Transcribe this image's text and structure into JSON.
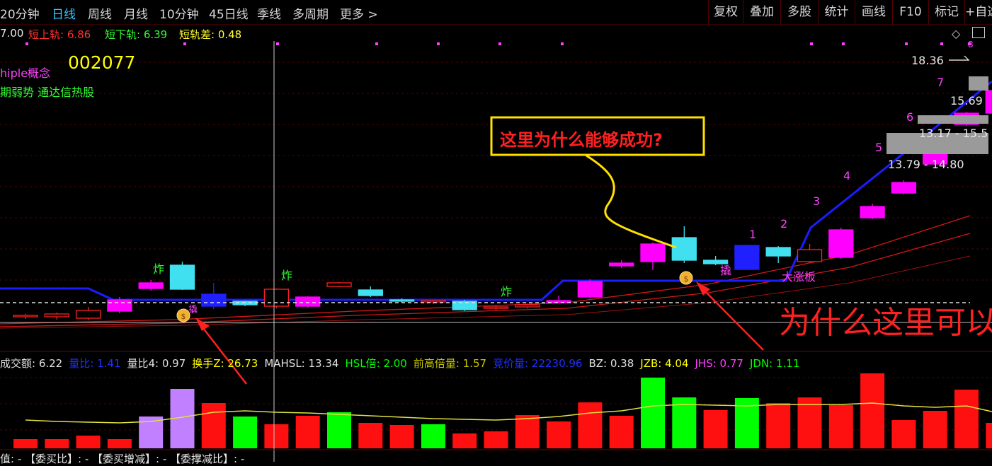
{
  "toolbar": {
    "periods": [
      {
        "label": "20分钟",
        "active": false
      },
      {
        "label": "日线",
        "active": true
      },
      {
        "label": "周线",
        "active": false
      },
      {
        "label": "月线",
        "active": false
      },
      {
        "label": "10分钟",
        "active": false
      },
      {
        "label": "45日线",
        "active": false
      },
      {
        "label": "季线",
        "active": false
      },
      {
        "label": "多周期",
        "active": false
      },
      {
        "label": "更多 >",
        "active": false
      }
    ],
    "buttons": [
      "复权",
      "叠加",
      "多股",
      "统计",
      "画线",
      "F10",
      "标记",
      "+自选"
    ]
  },
  "indicator_line": {
    "prefix": "7.00",
    "upper_label": "短上轨: ",
    "upper_value": "6.86",
    "lower_label": "短下轨: ",
    "lower_value": "6.39",
    "diff_label": "短轨差: ",
    "diff_value": "0.48"
  },
  "stock": {
    "concept": "hiple概念",
    "code": "002077",
    "trend": "期弱势 通达信热股"
  },
  "annotations": {
    "callout": "这里为什么能够成功?",
    "red_question": "为什么这里可以",
    "board": "大涨板",
    "zha_marks": [
      "炸",
      "炸",
      "炸"
    ],
    "tiao_mark": "撬",
    "lian_mark": "撬"
  },
  "price_labels": {
    "p1": "18.36",
    "p2": "15.69",
    "p3": "13.17 - 15.5",
    "p4": "13.79 - 14.80"
  },
  "step_numbers": [
    "1",
    "2",
    "3",
    "4",
    "5",
    "6",
    "7",
    "8"
  ],
  "volume_info": [
    {
      "label": "成交额: ",
      "value": "6.22",
      "color": "#e0e0e0"
    },
    {
      "label": "量比: ",
      "value": "1.41",
      "color": "#2030ff"
    },
    {
      "label": "量比4: ",
      "value": "0.97",
      "color": "#e0e0e0"
    },
    {
      "label": "换手Z: ",
      "value": "26.73",
      "color": "#ffff00"
    },
    {
      "label": "MAHSL: ",
      "value": "13.34",
      "color": "#e0e0e0"
    },
    {
      "label": "HSL倍: ",
      "value": "2.00",
      "color": "#00ff00"
    },
    {
      "label": "前高倍量: ",
      "value": "1.57",
      "color": "#c8c800"
    },
    {
      "label": "竞价量: ",
      "value": "22230.96",
      "color": "#2030ff"
    },
    {
      "label": "BZ: ",
      "value": "0.38",
      "color": "#e0e0e0"
    },
    {
      "label": "JZB: ",
      "value": "4.04",
      "color": "#ffff00"
    },
    {
      "label": "JHS: ",
      "value": "0.77",
      "color": "#ff40ff"
    },
    {
      "label": "JDN: ",
      "value": "1.11",
      "color": "#00ff00"
    }
  ],
  "bottom_bar": "值: - 【委买比】: - 【委买增减】: - 【委撑减比】: -",
  "chart_data": {
    "type": "candlestick",
    "candles": [
      {
        "o": 446,
        "c": 448,
        "h": 444,
        "l": 451,
        "col": "#ff2020",
        "fill": false
      },
      {
        "o": 448,
        "c": 444,
        "h": 442,
        "l": 452,
        "col": "#ff2020",
        "fill": false
      },
      {
        "o": 450,
        "c": 439,
        "h": 434,
        "l": 453,
        "col": "#ff2020",
        "fill": false
      },
      {
        "o": 440,
        "c": 424,
        "h": 420,
        "l": 443,
        "col": "#ff00ff",
        "fill": true
      },
      {
        "o": 408,
        "c": 400,
        "h": 396,
        "l": 411,
        "col": "#ff00ff",
        "fill": true
      },
      {
        "o": 409,
        "c": 375,
        "h": 370,
        "l": 410,
        "col": "#40e0f0",
        "fill": true
      },
      {
        "o": 416,
        "c": 433,
        "h": 400,
        "l": 437,
        "col": "#2020ff",
        "fill": true
      },
      {
        "o": 426,
        "c": 431,
        "h": 425,
        "l": 433,
        "col": "#40e0f0",
        "fill": true
      },
      {
        "o": 433,
        "c": 409,
        "h": 408,
        "l": 436,
        "col": "#ff2020",
        "fill": false
      },
      {
        "o": 420,
        "c": 433,
        "h": 419,
        "l": 435,
        "col": "#ff00ff",
        "fill": true
      },
      {
        "o": 405,
        "c": 400,
        "h": 399,
        "l": 406,
        "col": "#ff2020",
        "fill": false
      },
      {
        "o": 410,
        "c": 418,
        "h": 405,
        "l": 420,
        "col": "#40e0f0",
        "fill": true
      },
      {
        "o": 424,
        "c": 426,
        "h": 422,
        "l": 428,
        "col": "#40e0f0",
        "fill": true
      },
      {
        "o": 425,
        "c": 427,
        "h": 424,
        "l": 430,
        "col": "#ff2020",
        "fill": false
      },
      {
        "o": 426,
        "c": 438,
        "h": 424,
        "l": 440,
        "col": "#40e0f0",
        "fill": true
      },
      {
        "o": 434,
        "c": 436,
        "h": 432,
        "l": 438,
        "col": "#ff2020",
        "fill": false
      },
      {
        "o": 431,
        "c": 434,
        "h": 430,
        "l": 436,
        "col": "#ff2020",
        "fill": false
      },
      {
        "o": 428,
        "c": 425,
        "h": 418,
        "l": 429,
        "col": "#ff00ff",
        "fill": true
      },
      {
        "o": 420,
        "c": 398,
        "h": 395,
        "l": 422,
        "col": "#ff00ff",
        "fill": true
      },
      {
        "o": 376,
        "c": 372,
        "h": 368,
        "l": 379,
        "col": "#ff00ff",
        "fill": true
      },
      {
        "o": 370,
        "c": 345,
        "h": 343,
        "l": 382,
        "col": "#ff00ff",
        "fill": true
      },
      {
        "o": 368,
        "c": 336,
        "h": 320,
        "l": 372,
        "col": "#40e0f0",
        "fill": true
      },
      {
        "o": 368,
        "c": 373,
        "h": 362,
        "l": 375,
        "col": "#40e0f0",
        "fill": true
      },
      {
        "o": 347,
        "c": 381,
        "h": 346,
        "l": 381,
        "col": "#2020ff",
        "fill": true
      },
      {
        "o": 350,
        "c": 362,
        "h": 348,
        "l": 372,
        "col": "#40e0f0",
        "fill": true
      },
      {
        "o": 370,
        "c": 353,
        "h": 345,
        "l": 372,
        "col": "#ff2020",
        "fill": false
      },
      {
        "o": 364,
        "c": 325,
        "h": 322,
        "l": 366,
        "col": "#ff00ff",
        "fill": true
      },
      {
        "o": 308,
        "c": 292,
        "h": 288,
        "l": 310,
        "col": "#ff00ff",
        "fill": true
      },
      {
        "o": 273,
        "c": 258,
        "h": 255,
        "l": 275,
        "col": "#ff00ff",
        "fill": true
      },
      {
        "o": 232,
        "c": 218,
        "h": 215,
        "l": 234,
        "col": "#ff00ff",
        "fill": true
      },
      {
        "o": 176,
        "c": 160,
        "h": 158,
        "l": 178,
        "col": "#ff00ff",
        "fill": true
      },
      {
        "o": 160,
        "c": 128,
        "h": 125,
        "l": 162,
        "col": "#ff00ff",
        "fill": true
      },
      {
        "o": 102,
        "c": 73,
        "h": 60,
        "l": 104,
        "col": "#ff00ff",
        "fill": true
      }
    ],
    "volumes": [
      {
        "v": 13,
        "col": "#ff1010"
      },
      {
        "v": 13,
        "col": "#ff1010"
      },
      {
        "v": 18,
        "col": "#ff1010"
      },
      {
        "v": 13,
        "col": "#ff1010"
      },
      {
        "v": 45,
        "col": "#c080ff"
      },
      {
        "v": 84,
        "col": "#c080ff"
      },
      {
        "v": 64,
        "col": "#ff1010"
      },
      {
        "v": 45,
        "col": "#00ff00"
      },
      {
        "v": 34,
        "col": "#ff1010"
      },
      {
        "v": 46,
        "col": "#ff1010"
      },
      {
        "v": 51,
        "col": "#00ff00"
      },
      {
        "v": 36,
        "col": "#ff1010"
      },
      {
        "v": 33,
        "col": "#ff1010"
      },
      {
        "v": 34,
        "col": "#00ff00"
      },
      {
        "v": 21,
        "col": "#ff1010"
      },
      {
        "v": 24,
        "col": "#ff1010"
      },
      {
        "v": 47,
        "col": "#ff1010"
      },
      {
        "v": 38,
        "col": "#ff1010"
      },
      {
        "v": 65,
        "col": "#ff1010"
      },
      {
        "v": 46,
        "col": "#ff1010"
      },
      {
        "v": 100,
        "col": "#00ff00"
      },
      {
        "v": 72,
        "col": "#00ff00"
      },
      {
        "v": 54,
        "col": "#ff1010"
      },
      {
        "v": 71,
        "col": "#00ff00"
      },
      {
        "v": 64,
        "col": "#ff1010"
      },
      {
        "v": 72,
        "col": "#ff1010"
      },
      {
        "v": 61,
        "col": "#ff1010"
      },
      {
        "v": 106,
        "col": "#ff1010"
      },
      {
        "v": 40,
        "col": "#ff1010"
      },
      {
        "v": 53,
        "col": "#ff1010"
      },
      {
        "v": 83,
        "col": "#ff1010"
      },
      {
        "v": 36,
        "col": "#ff1010"
      }
    ],
    "vol_ma": [
      40,
      38,
      37,
      36,
      38,
      44,
      51,
      53,
      51,
      50,
      48,
      46,
      44,
      42,
      41,
      40,
      42,
      45,
      50,
      53,
      60,
      62,
      61,
      60,
      62,
      62,
      62,
      64,
      60,
      58,
      60,
      50
    ]
  },
  "colors": {
    "bg": "#000000",
    "grid": "#5a0000",
    "blue_line": "#1c1cff",
    "ma_red": "#d01818",
    "callout_border": "#ffe000",
    "callout_text": "#ff2020"
  }
}
